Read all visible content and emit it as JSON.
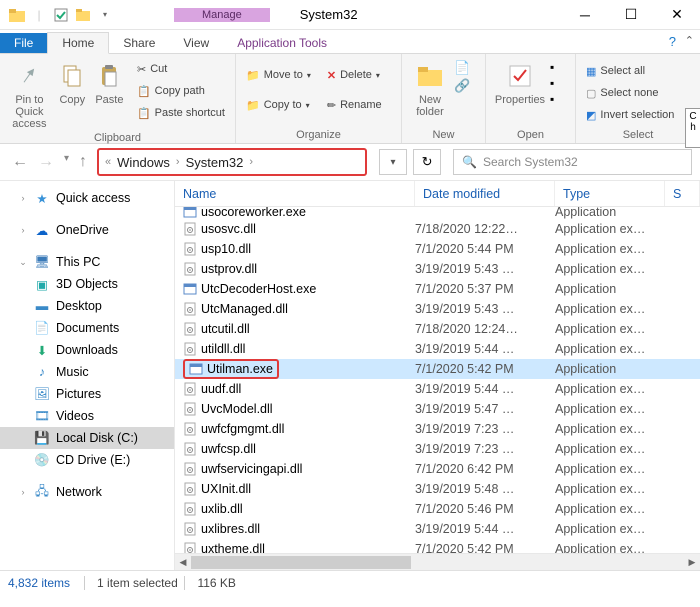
{
  "window": {
    "title": "System32",
    "manage_label": "Manage",
    "context_tab": "Application Tools"
  },
  "tabs": {
    "file": "File",
    "home": "Home",
    "share": "Share",
    "view": "View"
  },
  "ribbon": {
    "clipboard": {
      "label": "Clipboard",
      "pin": "Pin to Quick access",
      "copy": "Copy",
      "paste": "Paste",
      "cut": "Cut",
      "copy_path": "Copy path",
      "paste_shortcut": "Paste shortcut"
    },
    "organize": {
      "label": "Organize",
      "move_to": "Move to",
      "copy_to": "Copy to",
      "delete": "Delete",
      "rename": "Rename"
    },
    "new": {
      "label": "New",
      "new_folder": "New folder"
    },
    "open": {
      "label": "Open",
      "properties": "Properties"
    },
    "select": {
      "label": "Select",
      "select_all": "Select all",
      "select_none": "Select none",
      "invert": "Invert selection"
    }
  },
  "breadcrumb": {
    "segments": [
      "Windows",
      "System32"
    ]
  },
  "search": {
    "placeholder": "Search System32"
  },
  "sidebar": {
    "quick_access": "Quick access",
    "onedrive": "OneDrive",
    "this_pc": "This PC",
    "objects_3d": "3D Objects",
    "desktop": "Desktop",
    "documents": "Documents",
    "downloads": "Downloads",
    "music": "Music",
    "pictures": "Pictures",
    "videos": "Videos",
    "local_disk": "Local Disk (C:)",
    "cd_drive": "CD Drive (E:)",
    "network": "Network"
  },
  "columns": {
    "name": "Name",
    "date": "Date modified",
    "type": "Type",
    "size": "S"
  },
  "files": [
    {
      "name": "usocoreworker.exe",
      "date": "",
      "type": "Application",
      "icon": "exe",
      "partial": true
    },
    {
      "name": "usosvc.dll",
      "date": "7/18/2020 12:22…",
      "type": "Application ex…",
      "icon": "dll"
    },
    {
      "name": "usp10.dll",
      "date": "7/1/2020 5:44 PM",
      "type": "Application ex…",
      "icon": "dll"
    },
    {
      "name": "ustprov.dll",
      "date": "3/19/2019 5:43 …",
      "type": "Application ex…",
      "icon": "dll"
    },
    {
      "name": "UtcDecoderHost.exe",
      "date": "7/1/2020 5:37 PM",
      "type": "Application",
      "icon": "exe"
    },
    {
      "name": "UtcManaged.dll",
      "date": "3/19/2019 5:43 …",
      "type": "Application ex…",
      "icon": "dll"
    },
    {
      "name": "utcutil.dll",
      "date": "7/18/2020 12:24…",
      "type": "Application ex…",
      "icon": "dll"
    },
    {
      "name": "utildll.dll",
      "date": "3/19/2019 5:44 …",
      "type": "Application ex…",
      "icon": "dll"
    },
    {
      "name": "Utilman.exe",
      "date": "7/1/2020 5:42 PM",
      "type": "Application",
      "icon": "exe",
      "selected": true
    },
    {
      "name": "uudf.dll",
      "date": "3/19/2019 5:44 …",
      "type": "Application ex…",
      "icon": "dll"
    },
    {
      "name": "UvcModel.dll",
      "date": "3/19/2019 5:47 …",
      "type": "Application ex…",
      "icon": "dll"
    },
    {
      "name": "uwfcfgmgmt.dll",
      "date": "3/19/2019 7:23 …",
      "type": "Application ex…",
      "icon": "dll"
    },
    {
      "name": "uwfcsp.dll",
      "date": "3/19/2019 7:23 …",
      "type": "Application ex…",
      "icon": "dll"
    },
    {
      "name": "uwfservicingapi.dll",
      "date": "7/1/2020 6:42 PM",
      "type": "Application ex…",
      "icon": "dll"
    },
    {
      "name": "UXInit.dll",
      "date": "3/19/2019 5:48 …",
      "type": "Application ex…",
      "icon": "dll"
    },
    {
      "name": "uxlib.dll",
      "date": "7/1/2020 5:46 PM",
      "type": "Application ex…",
      "icon": "dll"
    },
    {
      "name": "uxlibres.dll",
      "date": "3/19/2019 5:44 …",
      "type": "Application ex…",
      "icon": "dll"
    },
    {
      "name": "uxtheme.dll",
      "date": "7/1/2020 5:42 PM",
      "type": "Application ex…",
      "icon": "dll"
    }
  ],
  "status": {
    "items": "4,832 items",
    "selected": "1 item selected",
    "size": "116 KB"
  },
  "tooltip": {
    "line1": "C",
    "line2": "h"
  }
}
